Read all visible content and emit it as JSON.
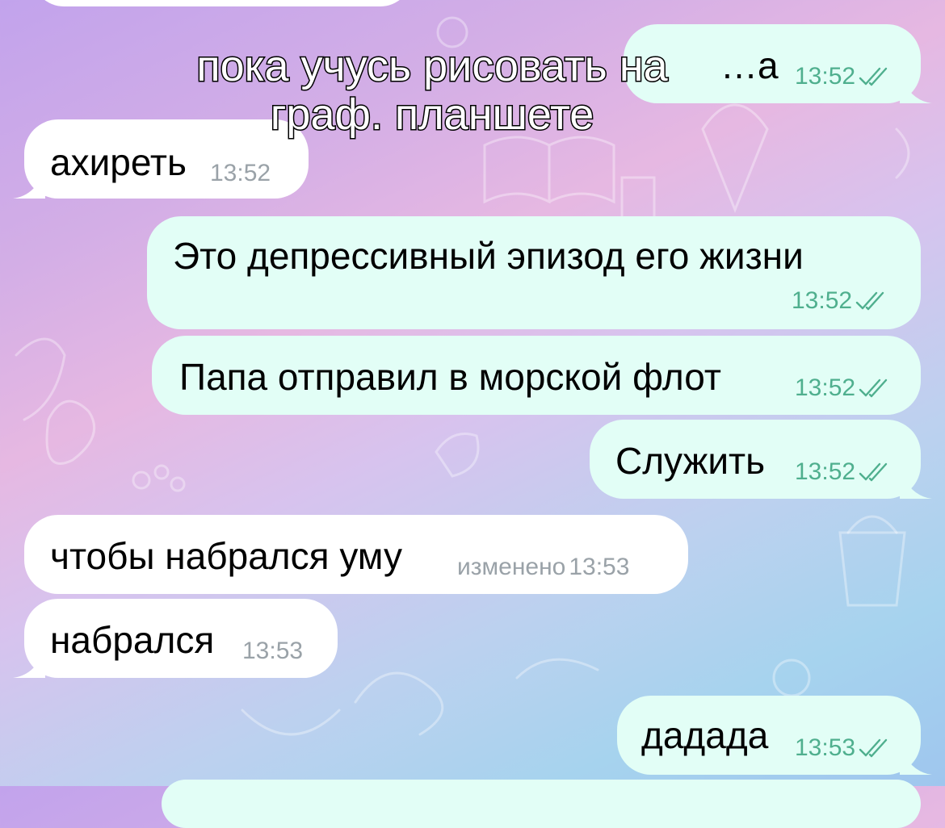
{
  "overlay_caption": [
    "пока учусь рисовать на",
    "граф. планшете"
  ],
  "messages": [
    {
      "side": "out",
      "text": "…а",
      "time": "13:52",
      "read": true
    },
    {
      "side": "in",
      "text": "ахиреть",
      "time": "13:52"
    },
    {
      "side": "out",
      "text": "Это депрессивный эпизод его жизни",
      "time": "13:52",
      "read": true
    },
    {
      "side": "out",
      "text": "Папа отправил в морской флот",
      "time": "13:52",
      "read": true
    },
    {
      "side": "out",
      "text": "Служить",
      "time": "13:52",
      "read": true
    },
    {
      "side": "in",
      "text": "чтобы набрался уму",
      "time": "13:53",
      "edited_label": "изменено"
    },
    {
      "side": "in",
      "text": "набрался",
      "time": "13:53"
    },
    {
      "side": "out",
      "text": "дадада",
      "time": "13:53",
      "read": true
    }
  ],
  "colors": {
    "incoming_bubble": "#ffffff",
    "outgoing_bubble": "#e2fef6",
    "outgoing_meta": "#4faf8e",
    "incoming_meta": "#9aa2a8"
  },
  "icons": {
    "read_receipt": "double-check-icon"
  }
}
